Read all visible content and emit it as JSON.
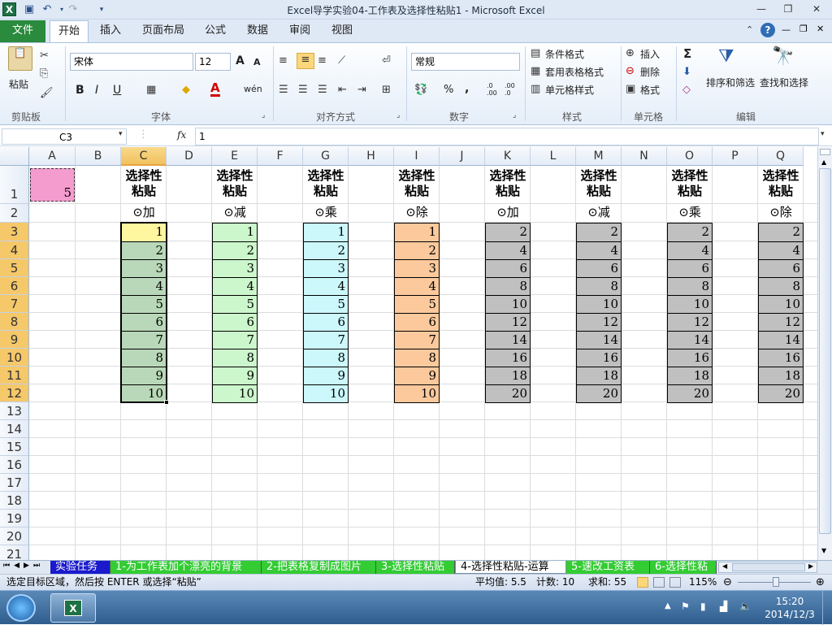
{
  "window": {
    "title": "Excel导学实验04-工作表及选择性粘贴1  -  Microsoft Excel",
    "logo_letter": "X",
    "controls": {
      "minimize": "—",
      "restore": "❐",
      "close": "✕"
    }
  },
  "ribbon_tabs": [
    {
      "label": "文件",
      "active": false,
      "is_file": true
    },
    {
      "label": "开始",
      "active": true
    },
    {
      "label": "插入",
      "active": false
    },
    {
      "label": "页面布局",
      "active": false
    },
    {
      "label": "公式",
      "active": false
    },
    {
      "label": "数据",
      "active": false
    },
    {
      "label": "审阅",
      "active": false
    },
    {
      "label": "视图",
      "active": false
    }
  ],
  "ribbon": {
    "clipboard": {
      "paste": "粘贴",
      "group": "剪贴板"
    },
    "font": {
      "name": "宋体",
      "size": "12",
      "group": "字体",
      "bold": "B",
      "italic": "I",
      "underline": "U",
      "grow": "A",
      "shrink": "A",
      "phonetic": "wén"
    },
    "alignment": {
      "group": "对齐方式"
    },
    "number": {
      "format": "常规",
      "group": "数字",
      "percent": "%",
      "comma": ",",
      "inc_dec": ".0 .00",
      "dec_dec": ".00 .0"
    },
    "styles": {
      "conditional": "条件格式",
      "table": "套用表格格式",
      "cell": "单元格样式",
      "group": "样式"
    },
    "cells": {
      "insert": "插入",
      "delete": "删除",
      "format": "格式",
      "group": "单元格"
    },
    "editing": {
      "sum": "Σ",
      "sort": "排序和筛选",
      "find": "查找和选择",
      "group": "编辑"
    }
  },
  "formula_bar": {
    "name_box": "C3",
    "fx": "fx",
    "value": "1"
  },
  "columns": [
    "A",
    "B",
    "C",
    "D",
    "E",
    "F",
    "G",
    "H",
    "I",
    "J",
    "K",
    "L",
    "M",
    "N",
    "O",
    "P",
    "Q"
  ],
  "selected_column": "C",
  "rows": [
    "1",
    "2",
    "3",
    "4",
    "5",
    "6",
    "7",
    "8",
    "9",
    "10",
    "11",
    "12",
    "13",
    "14",
    "15",
    "16",
    "17",
    "18",
    "19",
    "20",
    "21"
  ],
  "selected_rows": [
    "3",
    "4",
    "5",
    "6",
    "7",
    "8",
    "9",
    "10",
    "11",
    "12"
  ],
  "cell_a1": "5",
  "blocks": [
    {
      "col": "C",
      "title1": "选择性",
      "title2": "粘贴",
      "op": "⊙加",
      "values": [
        "1",
        "2",
        "3",
        "4",
        "5",
        "6",
        "7",
        "8",
        "9",
        "10"
      ],
      "fill": "#b9d8b9",
      "first_fill": "#fff6a0"
    },
    {
      "col": "E",
      "title1": "选择性",
      "title2": "粘贴",
      "op": "⊙减",
      "values": [
        "1",
        "2",
        "3",
        "4",
        "5",
        "6",
        "7",
        "8",
        "9",
        "10"
      ],
      "fill": "#ccf7cc"
    },
    {
      "col": "G",
      "title1": "选择性",
      "title2": "粘贴",
      "op": "⊙乘",
      "values": [
        "1",
        "2",
        "3",
        "4",
        "5",
        "6",
        "7",
        "8",
        "9",
        "10"
      ],
      "fill": "#ccf8fc"
    },
    {
      "col": "I",
      "title1": "选择性",
      "title2": "粘贴",
      "op": "⊙除",
      "values": [
        "1",
        "2",
        "3",
        "4",
        "5",
        "6",
        "7",
        "8",
        "9",
        "10"
      ],
      "fill": "#fcc99d"
    },
    {
      "col": "K",
      "title1": "选择性",
      "title2": "粘贴",
      "op": "⊙加",
      "values": [
        "2",
        "4",
        "6",
        "8",
        "10",
        "12",
        "14",
        "16",
        "18",
        "20"
      ],
      "fill": "#c0c0c0"
    },
    {
      "col": "M",
      "title1": "选择性",
      "title2": "粘贴",
      "op": "⊙减",
      "values": [
        "2",
        "4",
        "6",
        "8",
        "10",
        "12",
        "14",
        "16",
        "18",
        "20"
      ],
      "fill": "#c0c0c0"
    },
    {
      "col": "O",
      "title1": "选择性",
      "title2": "粘贴",
      "op": "⊙乘",
      "values": [
        "2",
        "4",
        "6",
        "8",
        "10",
        "12",
        "14",
        "16",
        "18",
        "20"
      ],
      "fill": "#c0c0c0"
    },
    {
      "col": "Q",
      "title1": "选择性",
      "title2": "粘贴",
      "op": "⊙除",
      "values": [
        "2",
        "4",
        "6",
        "8",
        "10",
        "12",
        "14",
        "16",
        "18",
        "20"
      ],
      "fill": "#c0c0c0"
    }
  ],
  "sheet_tabs": [
    {
      "label": "实验任务",
      "bg": "#1a1acc",
      "fg": "#ffffff"
    },
    {
      "label": "1-为工作表加个漂亮的背景",
      "bg": "#33cc33",
      "fg": "#ffffff"
    },
    {
      "label": "2-把表格复制成图片",
      "bg": "#33cc33",
      "fg": "#ffffff"
    },
    {
      "label": "3-选择性粘贴",
      "bg": "#33cc33",
      "fg": "#ffffff"
    },
    {
      "label": "4-选择性粘贴-运算",
      "bg": "#ffffff",
      "fg": "#000000",
      "active": true
    },
    {
      "label": "5-速改工资表",
      "bg": "#33cc33",
      "fg": "#ffffff"
    },
    {
      "label": "6-选择性粘",
      "bg": "#33cc33",
      "fg": "#ffffff"
    }
  ],
  "status": {
    "message": "选定目标区域，然后按 ENTER 或选择“粘贴”",
    "average": "平均值: 5.5",
    "count": "计数: 10",
    "sum": "求和: 55",
    "zoom": "115%"
  },
  "taskbar": {
    "time": "15:20",
    "date": "2014/12/3"
  }
}
